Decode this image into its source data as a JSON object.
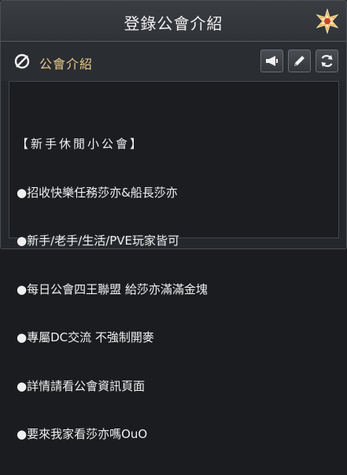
{
  "window": {
    "title": "登錄公會介紹"
  },
  "section": {
    "title": "公會介紹"
  },
  "toolbar": {
    "buttons": [
      {
        "name": "megaphone-button",
        "icon": "megaphone-icon"
      },
      {
        "name": "edit-button",
        "icon": "pencil-icon"
      },
      {
        "name": "refresh-button",
        "icon": "refresh-icon"
      }
    ]
  },
  "intro": {
    "lines": [
      "【新手休閒小公會】",
      "●招收快樂任務莎亦&船長莎亦",
      "●新手/老手/生活/PVE玩家皆可",
      "●每日公會四王聯盟 給莎亦滿滿金塊",
      "●專屬DC交流 不強制開麥",
      "●詳情請看公會資訊頁面",
      "●要來我家看莎亦嗎OuO"
    ]
  },
  "colors": {
    "section_title": "#e6c98a",
    "text": "#f0f0f0",
    "panel": "#24272b"
  }
}
